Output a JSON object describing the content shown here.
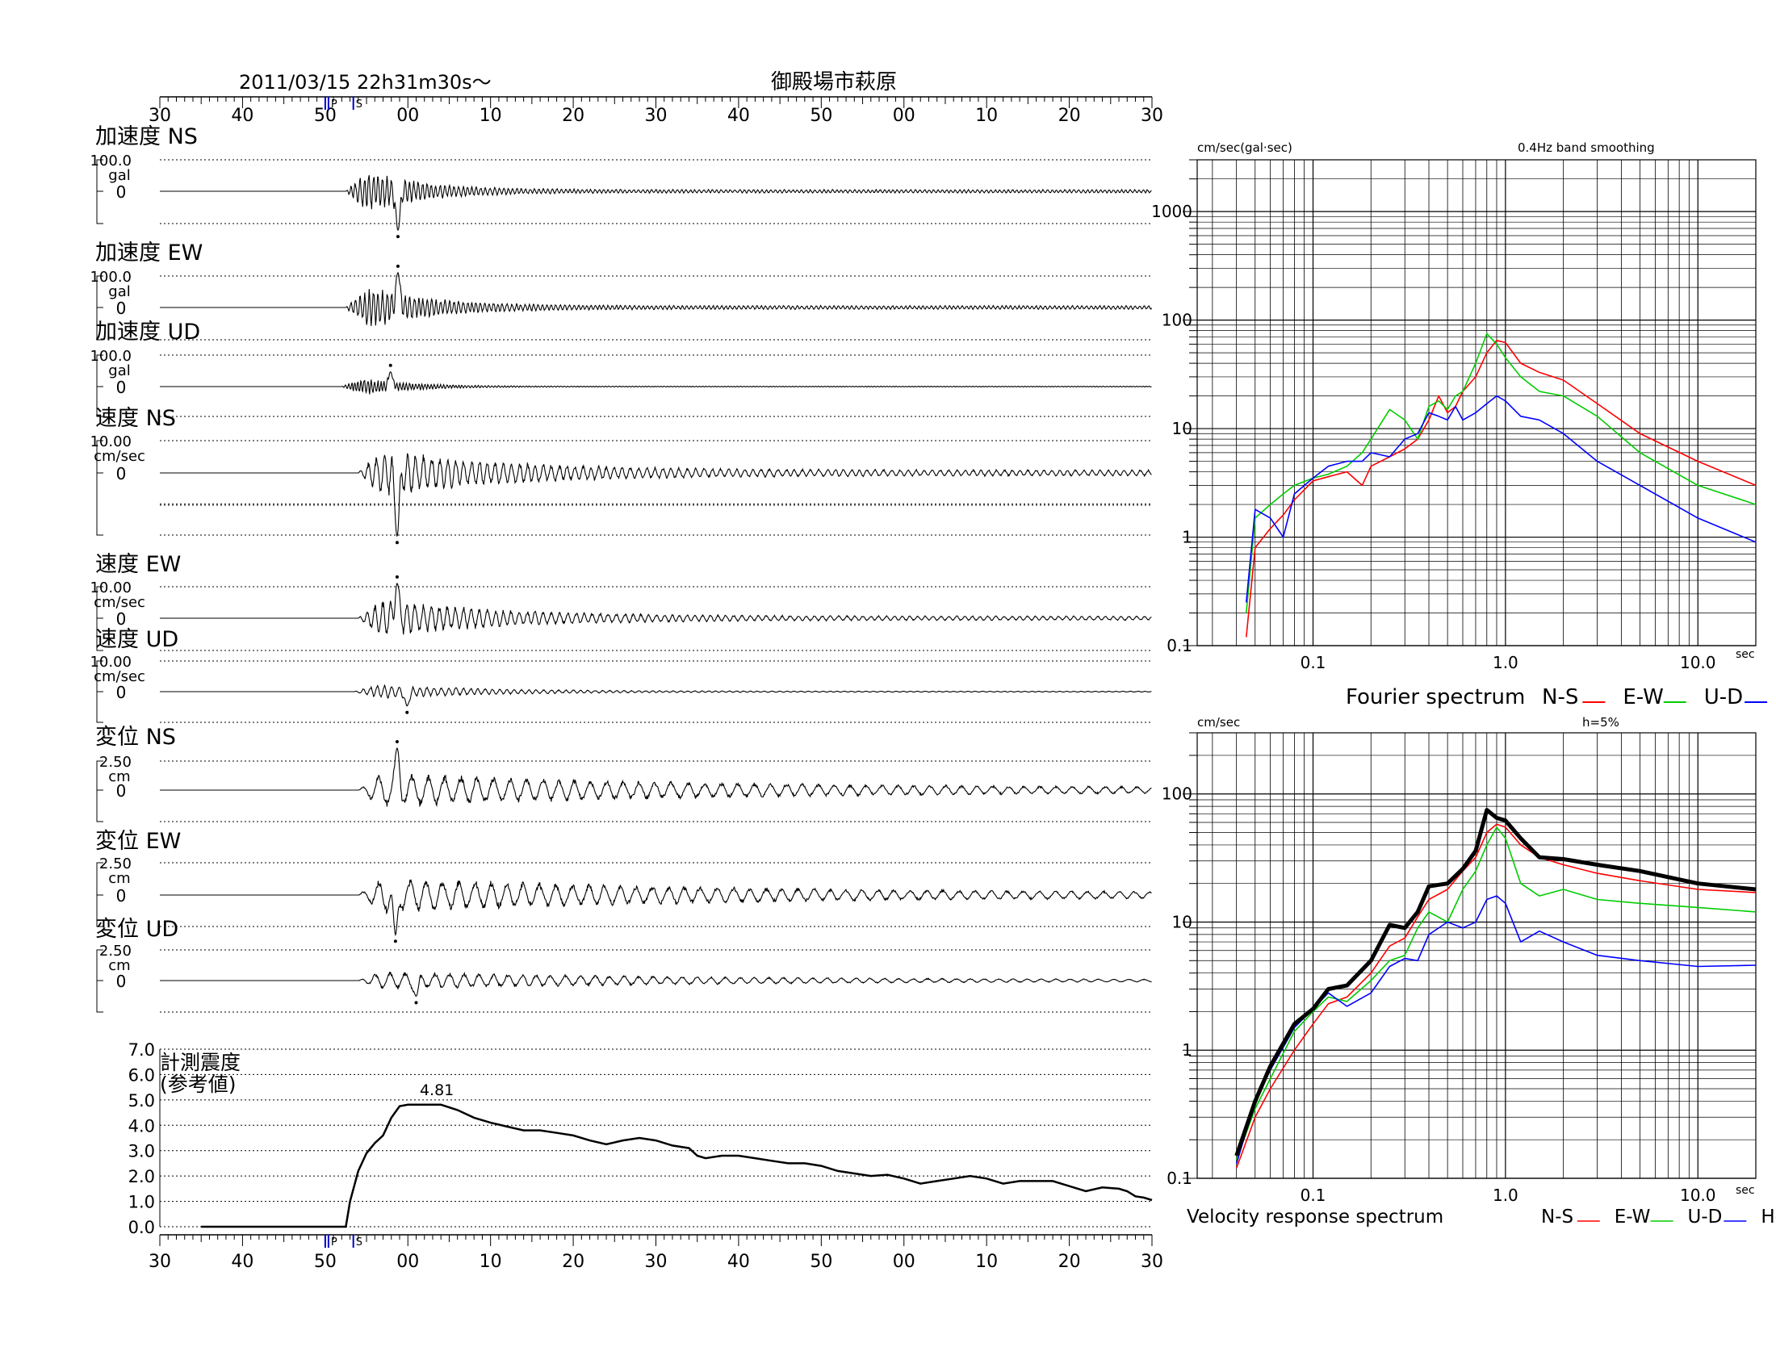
{
  "header": {
    "datetime": "2011/03/15  22h31m30s～",
    "station": "御殿場市萩原"
  },
  "time_axis": {
    "tick_labels": [
      "30",
      "40",
      "50",
      "00",
      "10",
      "20",
      "30",
      "40",
      "50",
      "00",
      "10",
      "20",
      "30"
    ],
    "p_marker": "P",
    "s_marker": "S"
  },
  "chart_data": [
    {
      "type": "line",
      "id": "waveforms",
      "x_unit": "seconds from 22h31m30s",
      "xlim": [
        0,
        120
      ],
      "p_arrival_s": 20.3,
      "s_arrival_s": 23.6,
      "channels": [
        {
          "label": "加速度 NS",
          "scale": "100.0",
          "unit": "gal",
          "zero": "0",
          "peak_s": 28.8,
          "peak": -1.45,
          "onset_s": 22.5,
          "amp": 1.0,
          "period": 0.55,
          "decay": 7,
          "seed": 11,
          "tail": 0.06
        },
        {
          "label": "加速度 EW",
          "scale": "100.0",
          "unit": "gal",
          "zero": "0",
          "peak_s": 28.8,
          "peak": 1.3,
          "onset_s": 22.5,
          "amp": 0.95,
          "period": 0.55,
          "decay": 8,
          "seed": 23,
          "tail": 0.07
        },
        {
          "label": "加速度 UD",
          "scale": "100.0",
          "unit": "gal",
          "zero": "0",
          "peak_s": 27.9,
          "peak": 0.55,
          "onset_s": 22.0,
          "amp": 0.45,
          "period": 0.4,
          "decay": 6,
          "seed": 37,
          "tail": 0.03
        },
        {
          "label": "速度 NS",
          "scale": "10.00",
          "unit": "cm/sec",
          "zero": "0",
          "peak_s": 28.7,
          "peak": -2.3,
          "onset_s": 24.0,
          "amp": 0.85,
          "period": 1.0,
          "decay": 16,
          "seed": 41,
          "tail": 0.12
        },
        {
          "label": "速度 EW",
          "scale": "10.00",
          "unit": "cm/sec",
          "zero": "0",
          "peak_s": 28.7,
          "peak": 1.3,
          "onset_s": 24.0,
          "amp": 0.75,
          "period": 1.0,
          "decay": 15,
          "seed": 53,
          "tail": 0.1
        },
        {
          "label": "速度 UD",
          "scale": "10.00",
          "unit": "cm/sec",
          "zero": "0",
          "peak_s": 29.9,
          "peak": -0.55,
          "onset_s": 23.5,
          "amp": 0.3,
          "period": 0.9,
          "decay": 14,
          "seed": 67,
          "tail": 0.05
        },
        {
          "label": "変位 NS",
          "scale": "2.50",
          "unit": "cm",
          "zero": "0",
          "peak_s": 28.7,
          "peak": 1.7,
          "onset_s": 24.0,
          "amp": 0.65,
          "period": 2.0,
          "decay": 40,
          "seed": 71,
          "tail": 0.12
        },
        {
          "label": "変位 EW",
          "scale": "2.50",
          "unit": "cm",
          "zero": "0",
          "peak_s": 28.5,
          "peak": -1.45,
          "onset_s": 24.0,
          "amp": 0.6,
          "period": 2.0,
          "decay": 40,
          "seed": 83,
          "tail": 0.12
        },
        {
          "label": "変位 UD",
          "scale": "2.50",
          "unit": "cm",
          "zero": "0",
          "peak_s": 31.0,
          "peak": -0.6,
          "onset_s": 24.0,
          "amp": 0.35,
          "period": 1.8,
          "decay": 40,
          "seed": 97,
          "tail": 0.05
        }
      ]
    },
    {
      "type": "line",
      "id": "intensity",
      "title_line1": "計測震度",
      "title_line2": "(参考値)",
      "yticks": [
        "0.0",
        "1.0",
        "2.0",
        "3.0",
        "4.0",
        "5.0",
        "6.0",
        "7.0"
      ],
      "ylim": [
        0,
        7
      ],
      "xlim": [
        0,
        120
      ],
      "max_label": "4.81",
      "max_x": 33.5,
      "points": [
        [
          5,
          0
        ],
        [
          22.5,
          0
        ],
        [
          23,
          1.0
        ],
        [
          24,
          2.2
        ],
        [
          25,
          2.9
        ],
        [
          26,
          3.3
        ],
        [
          27,
          3.6
        ],
        [
          28,
          4.3
        ],
        [
          29,
          4.75
        ],
        [
          30,
          4.81
        ],
        [
          34,
          4.81
        ],
        [
          36,
          4.6
        ],
        [
          38,
          4.3
        ],
        [
          40,
          4.1
        ],
        [
          42,
          3.95
        ],
        [
          44,
          3.8
        ],
        [
          46,
          3.8
        ],
        [
          48,
          3.7
        ],
        [
          50,
          3.6
        ],
        [
          52,
          3.4
        ],
        [
          54,
          3.25
        ],
        [
          56,
          3.4
        ],
        [
          58,
          3.5
        ],
        [
          60,
          3.4
        ],
        [
          62,
          3.2
        ],
        [
          64,
          3.1
        ],
        [
          65,
          2.8
        ],
        [
          66,
          2.7
        ],
        [
          68,
          2.8
        ],
        [
          70,
          2.8
        ],
        [
          72,
          2.7
        ],
        [
          74,
          2.6
        ],
        [
          76,
          2.5
        ],
        [
          78,
          2.5
        ],
        [
          80,
          2.4
        ],
        [
          82,
          2.2
        ],
        [
          84,
          2.1
        ],
        [
          86,
          2.0
        ],
        [
          88,
          2.05
        ],
        [
          90,
          1.9
        ],
        [
          92,
          1.7
        ],
        [
          94,
          1.8
        ],
        [
          96,
          1.9
        ],
        [
          98,
          2.0
        ],
        [
          100,
          1.9
        ],
        [
          102,
          1.7
        ],
        [
          104,
          1.8
        ],
        [
          106,
          1.8
        ],
        [
          108,
          1.8
        ],
        [
          110,
          1.6
        ],
        [
          112,
          1.4
        ],
        [
          114,
          1.55
        ],
        [
          116,
          1.5
        ],
        [
          117,
          1.4
        ],
        [
          118,
          1.2
        ],
        [
          119,
          1.15
        ],
        [
          120,
          1.05
        ]
      ]
    },
    {
      "type": "line",
      "id": "fourier",
      "ylabel": "cm/sec(gal·sec)",
      "note": "0.4Hz band smoothing",
      "x_scale": "log",
      "y_scale": "log",
      "xlim": [
        0.025,
        20
      ],
      "ylim": [
        0.1,
        3000
      ],
      "yticks": [
        "1000",
        "100",
        "10",
        "1",
        "0.1"
      ],
      "xticks": [
        "0.1",
        "1.0",
        "10.0"
      ],
      "x_unit": "sec",
      "legend_title": "Fourier spectrum",
      "series": [
        {
          "name": "N-S",
          "color": "#ff0000",
          "x": [
            0.045,
            0.05,
            0.06,
            0.07,
            0.08,
            0.1,
            0.12,
            0.15,
            0.18,
            0.2,
            0.25,
            0.3,
            0.35,
            0.4,
            0.45,
            0.5,
            0.55,
            0.6,
            0.7,
            0.8,
            0.9,
            1.0,
            1.2,
            1.5,
            2,
            3,
            5,
            10,
            20
          ],
          "y": [
            0.12,
            0.8,
            1.2,
            1.6,
            2.2,
            3.3,
            3.6,
            4.0,
            3.0,
            4.5,
            5.5,
            6.5,
            8.0,
            12,
            20,
            14,
            16,
            22,
            30,
            50,
            65,
            62,
            40,
            33,
            28,
            17,
            9,
            5,
            3
          ]
        },
        {
          "name": "E-W",
          "color": "#00cc00",
          "x": [
            0.045,
            0.05,
            0.06,
            0.07,
            0.08,
            0.1,
            0.12,
            0.15,
            0.18,
            0.2,
            0.25,
            0.3,
            0.35,
            0.4,
            0.45,
            0.5,
            0.55,
            0.6,
            0.7,
            0.8,
            0.9,
            1.0,
            1.2,
            1.5,
            2,
            3,
            5,
            10,
            20
          ],
          "y": [
            0.2,
            1.5,
            2.0,
            2.5,
            3.0,
            3.5,
            3.8,
            4.5,
            6.0,
            8.0,
            15,
            12,
            8,
            16,
            18,
            15,
            20,
            22,
            40,
            75,
            60,
            45,
            30,
            22,
            20,
            13,
            6,
            3,
            2
          ]
        },
        {
          "name": "U-D",
          "color": "#0000ff",
          "x": [
            0.045,
            0.05,
            0.06,
            0.07,
            0.08,
            0.1,
            0.12,
            0.15,
            0.18,
            0.2,
            0.25,
            0.3,
            0.35,
            0.4,
            0.45,
            0.5,
            0.55,
            0.6,
            0.7,
            0.8,
            0.9,
            1.0,
            1.2,
            1.5,
            2,
            3,
            5,
            10,
            20
          ],
          "y": [
            0.25,
            1.8,
            1.5,
            1.0,
            2.5,
            3.5,
            4.5,
            5.0,
            5.0,
            6.0,
            5.5,
            8.0,
            9.0,
            14,
            13,
            12,
            16,
            12,
            14,
            17,
            20,
            18,
            13,
            12,
            9,
            5,
            3,
            1.5,
            0.9
          ]
        }
      ]
    },
    {
      "type": "line",
      "id": "response",
      "ylabel": "cm/sec",
      "note": "h=5%",
      "x_scale": "log",
      "y_scale": "log",
      "xlim": [
        0.025,
        20
      ],
      "ylim": [
        0.1,
        300
      ],
      "yticks": [
        "100",
        "10",
        "1",
        "0.1"
      ],
      "xticks": [
        "0.1",
        "1.0",
        "10.0"
      ],
      "x_unit": "sec",
      "legend_title": "Velocity response spectrum",
      "series": [
        {
          "name": "N-S",
          "color": "#ff0000",
          "width": 1.6,
          "x": [
            0.04,
            0.05,
            0.06,
            0.08,
            0.1,
            0.12,
            0.15,
            0.2,
            0.25,
            0.3,
            0.35,
            0.4,
            0.5,
            0.6,
            0.7,
            0.8,
            0.9,
            1.0,
            1.2,
            1.5,
            2,
            3,
            5,
            10,
            20
          ],
          "y": [
            0.12,
            0.3,
            0.5,
            1.0,
            1.6,
            2.3,
            2.6,
            4.0,
            6.5,
            7.5,
            11,
            15,
            18,
            25,
            32,
            50,
            58,
            55,
            40,
            32,
            28,
            24,
            21,
            18,
            17
          ]
        },
        {
          "name": "E-W",
          "color": "#00cc00",
          "width": 1.6,
          "x": [
            0.04,
            0.05,
            0.06,
            0.08,
            0.1,
            0.12,
            0.15,
            0.2,
            0.25,
            0.3,
            0.35,
            0.4,
            0.5,
            0.6,
            0.7,
            0.8,
            0.9,
            1.0,
            1.2,
            1.5,
            2,
            3,
            5,
            10,
            20
          ],
          "y": [
            0.14,
            0.35,
            0.6,
            1.4,
            2.0,
            2.6,
            2.4,
            3.5,
            5.0,
            5.5,
            9.0,
            12,
            10,
            18,
            25,
            40,
            55,
            45,
            20,
            16,
            18,
            15,
            14,
            13,
            12
          ]
        },
        {
          "name": "U-D",
          "color": "#0000ff",
          "width": 1.6,
          "x": [
            0.04,
            0.05,
            0.06,
            0.08,
            0.1,
            0.12,
            0.15,
            0.2,
            0.25,
            0.3,
            0.35,
            0.4,
            0.5,
            0.6,
            0.7,
            0.8,
            0.9,
            1.0,
            1.2,
            1.5,
            2,
            3,
            5,
            10,
            20
          ],
          "y": [
            0.13,
            0.4,
            0.7,
            1.5,
            2.1,
            2.8,
            2.2,
            2.8,
            4.5,
            5.2,
            5.0,
            8.0,
            10,
            9.0,
            10,
            15,
            16,
            14,
            7,
            8.5,
            7,
            5.5,
            5,
            4.5,
            4.6
          ]
        },
        {
          "name": "Horizon",
          "color": "#000000",
          "width": 5,
          "x": [
            0.04,
            0.05,
            0.06,
            0.08,
            0.1,
            0.12,
            0.15,
            0.2,
            0.25,
            0.3,
            0.35,
            0.4,
            0.5,
            0.6,
            0.7,
            0.8,
            0.9,
            1.0,
            1.2,
            1.5,
            2,
            3,
            5,
            10,
            20
          ],
          "y": [
            0.15,
            0.4,
            0.75,
            1.6,
            2.1,
            3.0,
            3.2,
            5.0,
            9.5,
            9.0,
            12,
            19,
            20,
            26,
            36,
            75,
            65,
            62,
            45,
            32,
            31,
            28,
            25,
            20,
            18
          ]
        }
      ]
    }
  ]
}
